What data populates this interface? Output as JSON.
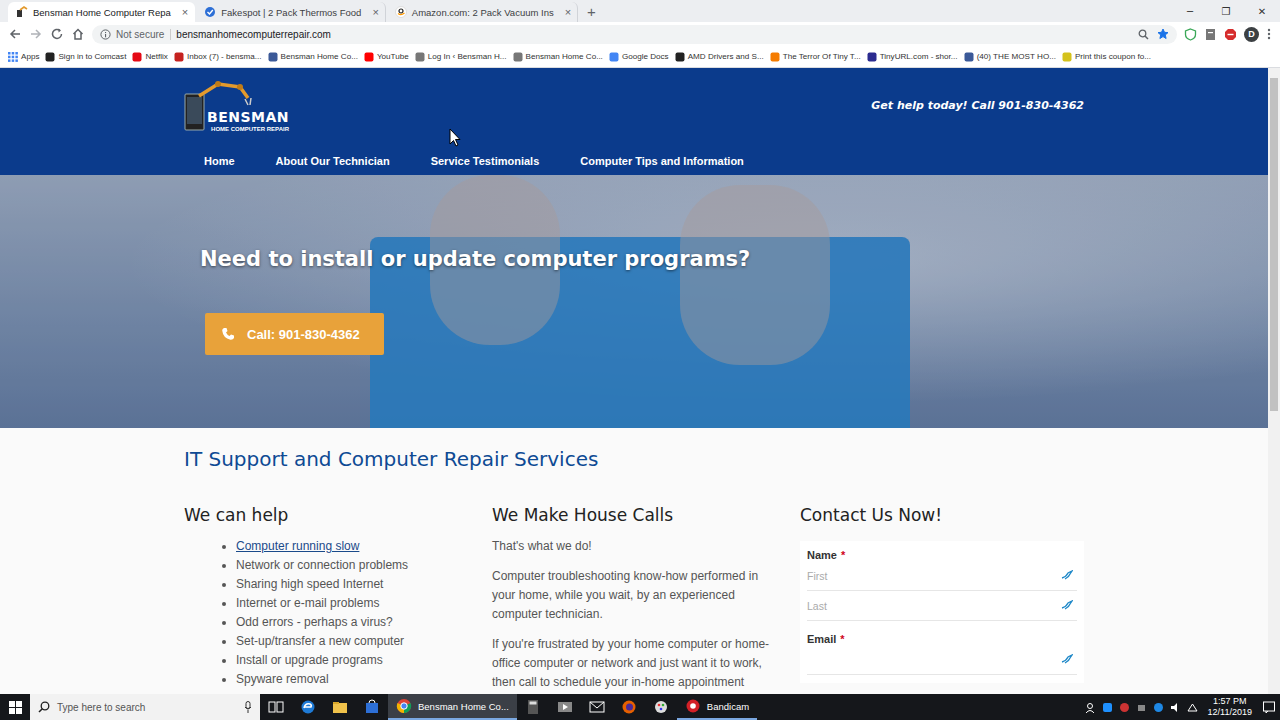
{
  "browser": {
    "tabs": [
      {
        "label": "Bensman Home Computer Repa",
        "selected": true
      },
      {
        "label": "Fakespot | 2 Pack Thermos Food",
        "selected": false
      },
      {
        "label": "Amazon.com: 2 Pack Vacuum Ins",
        "selected": false
      }
    ],
    "tab_close": "×",
    "new_tab": "+",
    "window_controls": [
      "─",
      "❐",
      "✕"
    ],
    "security": "Not secure",
    "url": "bensmanhomecomputerrepair.com",
    "bookmarked": true,
    "profile": "D",
    "bookmarks": [
      "Apps",
      "Sign in to Comcast",
      "Netflix",
      "Inbox (7) - bensma...",
      "Bensman Home Co...",
      "YouTube",
      "Log In ‹ Bensman H...",
      "Bensman Home Co...",
      "Google Docs",
      "AMD Drivers and S...",
      "The Terror Of Tiny T...",
      "TinyURL.com - shor...",
      "(40) THE MOST HO...",
      "Print this coupon fo..."
    ]
  },
  "page": {
    "header": {
      "logo_name": "BENSMAN",
      "logo_tagline": "HOME COMPUTER REPAIR",
      "phone_line": "Get help today! Call 901-830-4362",
      "nav": [
        "Home",
        "About Our Technician",
        "Service Testimonials",
        "Computer Tips and Information"
      ]
    },
    "hero": {
      "title": "Need to install or update computer programs?",
      "button": "Call: 901-830-4362"
    },
    "section_title": "IT Support and Computer Repair Services",
    "help": {
      "title": "We can help",
      "items": [
        {
          "label": "Computer running slow",
          "kind": "link"
        },
        {
          "label": "Network or connection problems",
          "kind": "plain"
        },
        {
          "label": "Sharing high speed Internet",
          "kind": "plain"
        },
        {
          "label": "Internet or e-mail problems",
          "kind": "plain"
        },
        {
          "label": "Odd errors - perhaps a virus?",
          "kind": "plain"
        },
        {
          "label": "Set-up/transfer a new computer",
          "kind": "plain"
        },
        {
          "label": "Install or upgrade programs",
          "kind": "plain"
        },
        {
          "label": "Spyware removal",
          "kind": "plain"
        }
      ]
    },
    "house_calls": {
      "title": "We Make House Calls",
      "paragraphs": [
        "That's what we do!",
        "Computer troubleshooting know-how performed in your home, while you wait, by an experienced computer technician.",
        "If you're frustrated by your home computer or home-office computer or network and just want it to work, then call to schedule your in-home appointment"
      ]
    },
    "contact": {
      "title": "Contact Us Now!",
      "fields": [
        {
          "label": "Name",
          "mark": "*",
          "inputs": [
            "First",
            "Last"
          ]
        },
        {
          "label": "Email",
          "mark": "*",
          "inputs": [
            ""
          ]
        }
      ]
    }
  },
  "scrollbar": {
    "level": 0.55
  },
  "taskbar": {
    "search": "Type here to search",
    "apps": [
      {
        "label": "Bensman Home Co...",
        "active": true
      },
      {
        "label": "Bandicam",
        "active": false
      }
    ],
    "time": "1:57 PM",
    "date": "12/11/2019"
  }
}
